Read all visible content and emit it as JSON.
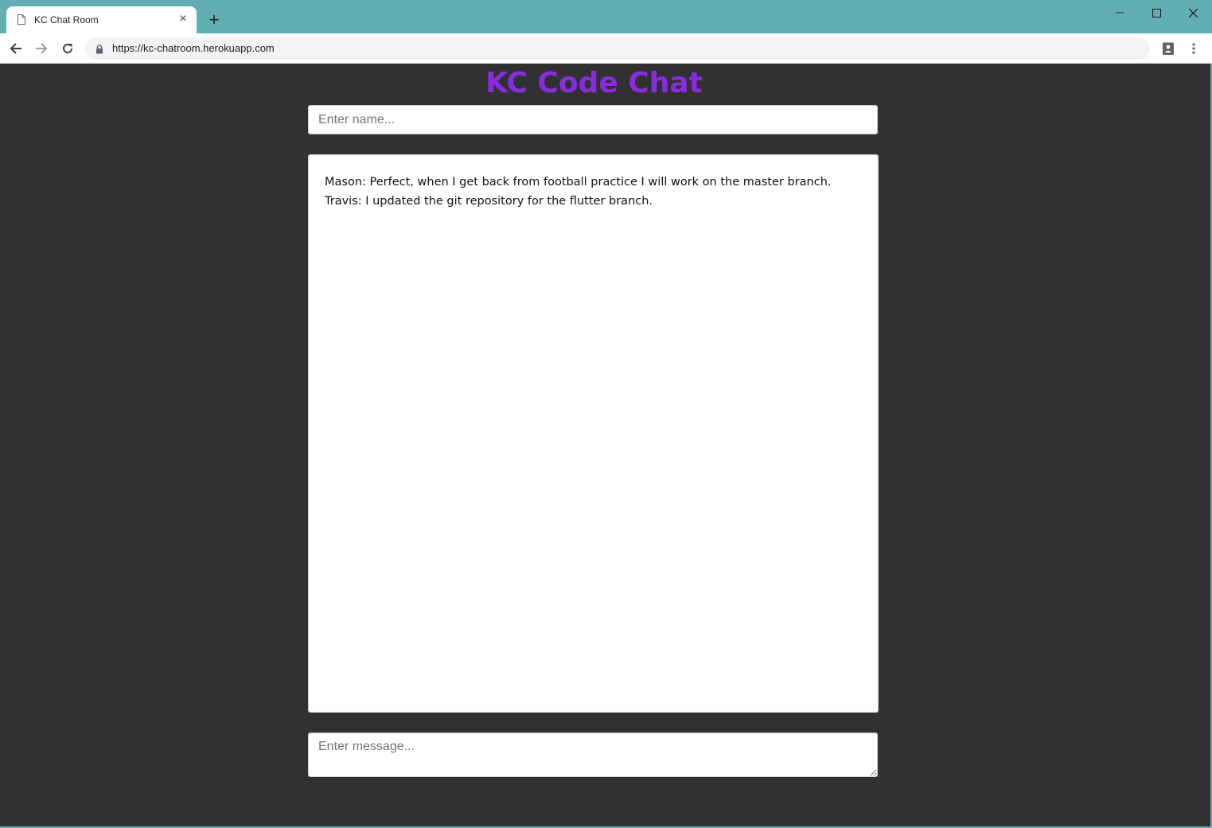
{
  "browser": {
    "tab_title": "KC Chat Room",
    "url": "https://kc-chatroom.herokuapp.com"
  },
  "page": {
    "heading": "KC Code Chat",
    "name_placeholder": "Enter name...",
    "message_placeholder": "Enter message...",
    "messages": [
      "Mason: Perfect, when I get back from football practice I will work on the master branch.",
      "Travis: I updated the git repository for the flutter branch."
    ]
  },
  "colors": {
    "accent": "#8a2be2",
    "page_background": "#313131",
    "titlebar": "#61aeb3"
  }
}
